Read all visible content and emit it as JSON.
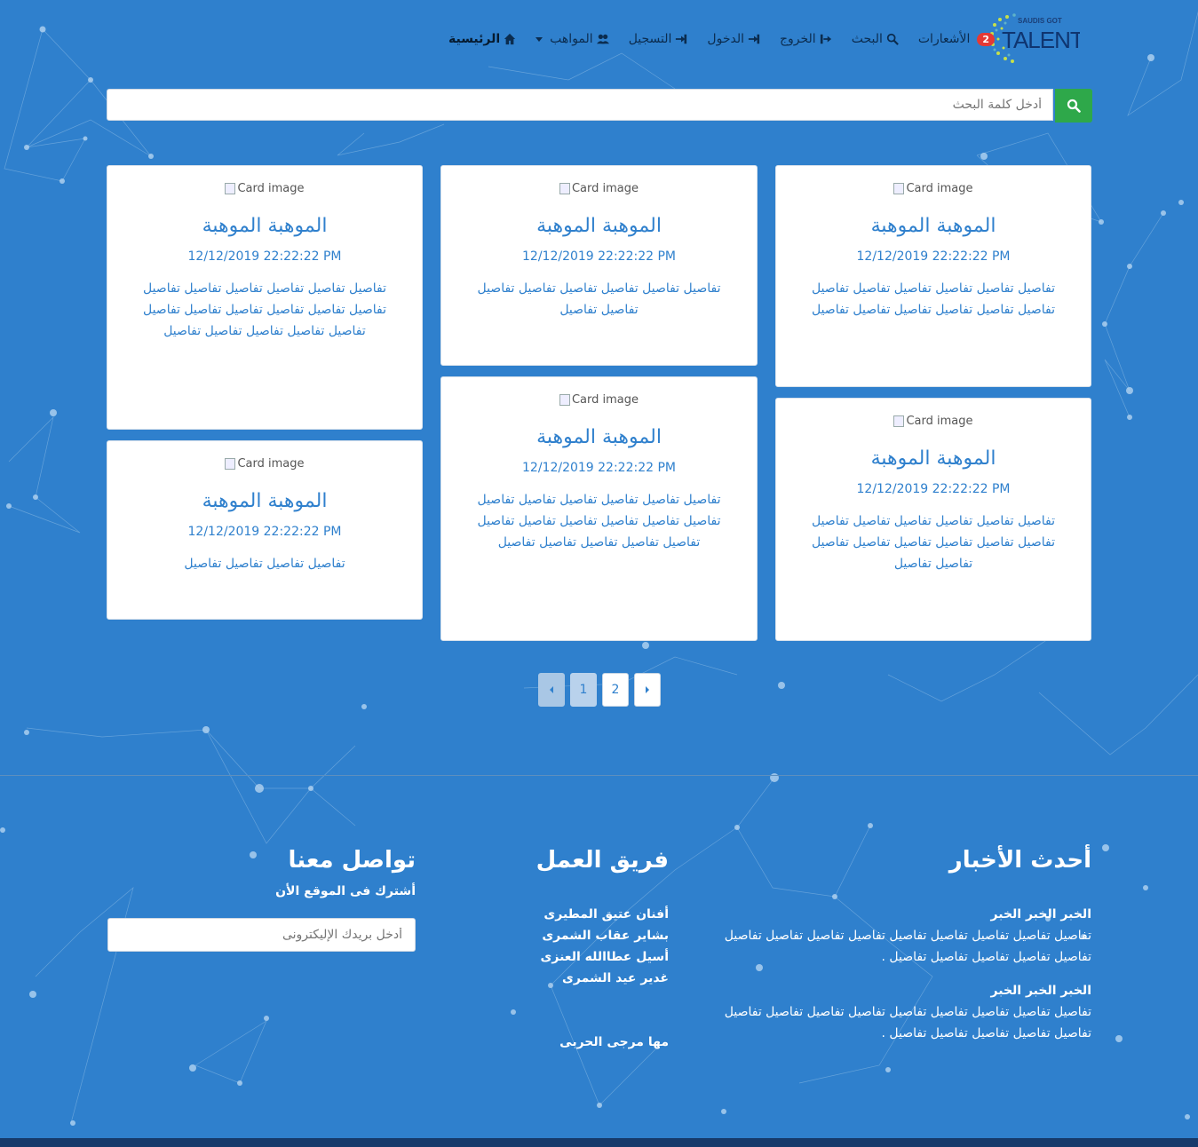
{
  "logo": {
    "main": "TALENT",
    "sub": "SAUDIS GOT"
  },
  "nav": [
    {
      "label": "الرئيسية",
      "icon": "home-icon",
      "active": true
    },
    {
      "label": "المواهب",
      "icon": "users-icon",
      "dropdown": true
    },
    {
      "label": "التسجيل",
      "icon": "register-icon"
    },
    {
      "label": "الدخول",
      "icon": "login-icon"
    },
    {
      "label": "الخروج",
      "icon": "logout-icon"
    },
    {
      "label": "البحث",
      "icon": "search-icon"
    },
    {
      "label": "الأشعارات",
      "badge": "2"
    }
  ],
  "search": {
    "placeholder": "أدخل كلمة البحث"
  },
  "card_alt": "Card image",
  "cards": [
    {
      "title": "الموهبة الموهبة",
      "date": "12/12/2019 22:22:22 PM",
      "text": "تفاصيل تفاصيل تفاصيل تفاصيل تفاصيل تفاصيل تفاصيل تفاصيل تفاصيل تفاصيل تفاصيل تفاصيل"
    },
    {
      "title": "الموهبة الموهبة",
      "date": "12/12/2019 22:22:22 PM",
      "text": "تفاصيل تفاصيل تفاصيل تفاصيل تفاصيل تفاصيل تفاصيل تفاصيل"
    },
    {
      "title": "الموهبة الموهبة",
      "date": "12/12/2019 22:22:22 PM",
      "text": "تفاصيل تفاصيل تفاصيل تفاصيل تفاصيل تفاصيل تفاصيل تفاصيل تفاصيل تفاصيل تفاصيل تفاصيل تفاصيل تفاصيل تفاصيل تفاصيل تفاصيل"
    },
    {
      "title": "الموهبة الموهبة",
      "date": "12/12/2019 22:22:22 PM",
      "text": "تفاصيل تفاصيل تفاصيل تفاصيل تفاصيل تفاصيل تفاصيل تفاصيل تفاصيل تفاصيل تفاصيل تفاصيل تفاصيل تفاصيل"
    },
    {
      "title": "الموهبة الموهبة",
      "date": "12/12/2019 22:22:22 PM",
      "text": "تفاصيل تفاصيل تفاصيل تفاصيل تفاصيل تفاصيل تفاصيل تفاصيل تفاصيل تفاصيل تفاصيل تفاصيل تفاصيل تفاصيل تفاصيل تفاصيل تفاصيل"
    },
    {
      "title": "الموهبة الموهبة",
      "date": "12/12/2019 22:22:22 PM",
      "text": "تفاصيل تفاصيل تفاصيل تفاصيل"
    }
  ],
  "pagination": {
    "pages": [
      "1",
      "2"
    ],
    "active": "1"
  },
  "footer": {
    "news": {
      "title": "أحدث الأخبار",
      "items": [
        {
          "heading": "الخبر الخبر الخبر",
          "body": "تفاصيل تفاصيل تفاصيل تفاصيل تفاصيل تفاصيل تفاصيل تفاصيل تفاصيل تفاصيل تفاصيل تفاصيل تفاصيل تفاصيل ."
        },
        {
          "heading": "الخبر الخبر الخبر",
          "body": "تفاصيل تفاصيل تفاصيل تفاصيل تفاصيل تفاصيل تفاصيل تفاصيل تفاصيل تفاصيل تفاصيل تفاصيل تفاصيل تفاصيل ."
        }
      ]
    },
    "team": {
      "title": "فريق العمل",
      "members": [
        "أفنان عتيق المطيرى",
        "بشاير عقاب الشمرى",
        "أسيل عطاالله العنزى",
        "غدير عيد الشمرى"
      ],
      "extra": "مها مرجى الحربى"
    },
    "contact": {
      "title": "تواصل معنا",
      "subtitle": "أشترك فى الموقع الأن",
      "email_placeholder": "أدخل بريدك الإليكترونى"
    }
  },
  "colors": {
    "background": "#2f80cd",
    "search_button": "#2ea84a",
    "badge": "#e53935",
    "bottom_bar": "#163a6b"
  }
}
